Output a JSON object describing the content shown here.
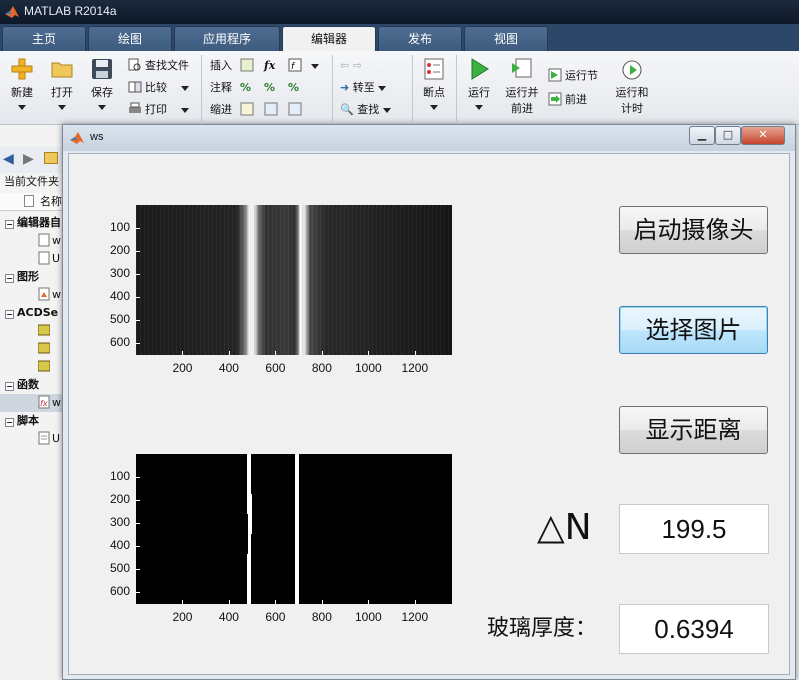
{
  "app": {
    "title": "MATLAB R2014a"
  },
  "tabs": [
    {
      "label": "主页"
    },
    {
      "label": "绘图"
    },
    {
      "label": "应用程序"
    },
    {
      "label": "编辑器"
    },
    {
      "label": "发布"
    },
    {
      "label": "视图"
    }
  ],
  "ribbon": {
    "new": "新建",
    "open": "打开",
    "save": "保存",
    "find_files": "查找文件",
    "compare": "比较",
    "print": "打印",
    "insert": "插入",
    "comment": "注释",
    "indent": "缩进",
    "fx": "fx",
    "goto": "转至",
    "find": "查找",
    "breakpoints": "断点",
    "run": "运行",
    "run_advance_l1": "运行并",
    "run_advance_l2": "前进",
    "run_section": "运行节",
    "advance": "前进",
    "run_time_l1": "运行和",
    "run_time_l2": "计时"
  },
  "left_panel": {
    "current_folder": "当前文件夹",
    "name_col": "名称",
    "sections": [
      {
        "label": "编辑器自",
        "files": [
          "w",
          "U"
        ]
      },
      {
        "label": "图形",
        "files": [
          "w"
        ]
      },
      {
        "label": "ACDSe",
        "files": [
          "",
          "",
          ""
        ]
      },
      {
        "label": "函数",
        "files": [
          "w"
        ]
      },
      {
        "label": "脚本",
        "files": [
          "U"
        ]
      }
    ]
  },
  "figure": {
    "title": "ws",
    "controls": {
      "minimize": "▁",
      "maximize": "□",
      "close": "✕"
    },
    "buttons": {
      "start_camera": "启动摄像头",
      "select_image": "选择图片",
      "show_distance": "显示距离"
    },
    "delta_n": {
      "label": "△N",
      "value": "199.5"
    },
    "thickness": {
      "label": "玻璃厚度：",
      "value": "0.6394"
    },
    "axes_top": {
      "yticks": [
        "100",
        "200",
        "300",
        "400",
        "500",
        "600"
      ],
      "xticks": [
        "200",
        "400",
        "600",
        "800",
        "1000",
        "1200"
      ]
    },
    "axes_bottom": {
      "yticks": [
        "100",
        "200",
        "300",
        "400",
        "500",
        "600"
      ],
      "xticks": [
        "200",
        "400",
        "600",
        "800",
        "1000",
        "1200"
      ]
    }
  },
  "colors": {
    "titlebar": "#13202f",
    "tab_active": "#f1f1f1",
    "button_focus": "#bee6fd",
    "axes_bg": "#000000"
  }
}
